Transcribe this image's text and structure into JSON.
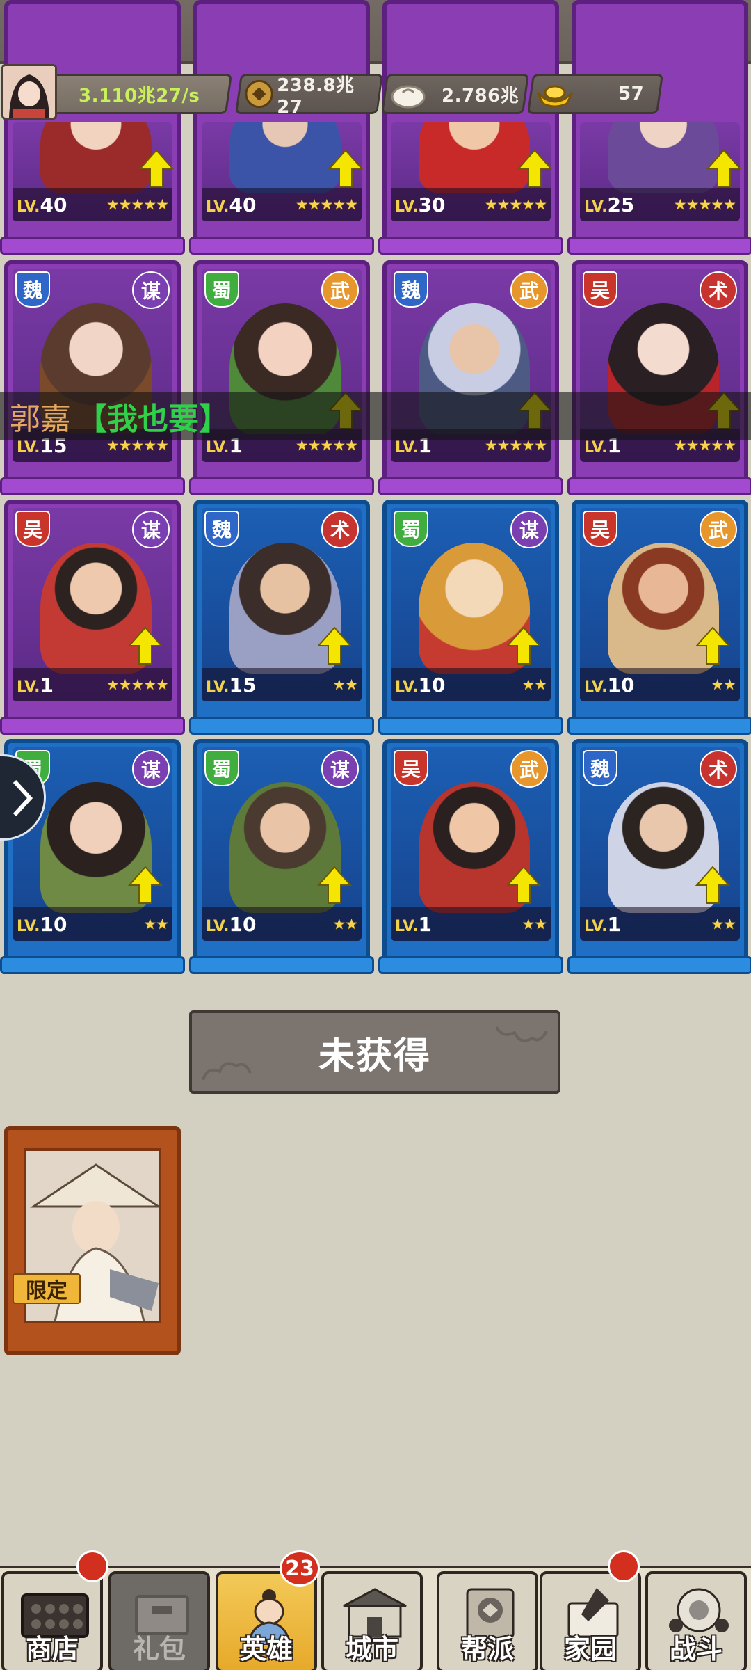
{
  "resources": {
    "income_rate": "3.110兆27/s",
    "copper": "238.8兆27",
    "buns": "2.786兆",
    "gold": "57"
  },
  "top_row_heroes": [
    {
      "level": "40",
      "stars": "★★★★★",
      "color": "purple"
    },
    {
      "level": "40",
      "stars": "★★★★★",
      "color": "purple"
    },
    {
      "level": "30",
      "stars": "★★★★★",
      "color": "purple"
    },
    {
      "level": "25",
      "stars": "★★★★★",
      "color": "purple"
    }
  ],
  "heroes": [
    {
      "faction": "魏",
      "type": "谋",
      "level": "15",
      "stars": "★★★★★",
      "color": "purple"
    },
    {
      "faction": "蜀",
      "type": "武",
      "level": "1",
      "stars": "★★★★★",
      "color": "purple"
    },
    {
      "faction": "魏",
      "type": "武",
      "level": "1",
      "stars": "★★★★★",
      "color": "purple"
    },
    {
      "faction": "吴",
      "type": "术",
      "level": "1",
      "stars": "★★★★★",
      "color": "purple"
    },
    {
      "faction": "吴",
      "type": "谋",
      "level": "1",
      "stars": "★★★★★",
      "color": "purple"
    },
    {
      "faction": "魏",
      "type": "术",
      "level": "15",
      "stars": "★★",
      "color": "blue"
    },
    {
      "faction": "蜀",
      "type": "谋",
      "level": "10",
      "stars": "★★",
      "color": "blue"
    },
    {
      "faction": "吴",
      "type": "武",
      "level": "10",
      "stars": "★★",
      "color": "blue"
    },
    {
      "faction": "蜀",
      "type": "谋",
      "level": "10",
      "stars": "★★",
      "color": "blue"
    },
    {
      "faction": "蜀",
      "type": "谋",
      "level": "10",
      "stars": "★★",
      "color": "blue"
    },
    {
      "faction": "吴",
      "type": "武",
      "level": "1",
      "stars": "★★",
      "color": "blue"
    },
    {
      "faction": "魏",
      "type": "术",
      "level": "1",
      "stars": "★★",
      "color": "blue"
    }
  ],
  "level_prefix": "LV.",
  "ticker": {
    "name": "郭嘉",
    "message": "【我也要】"
  },
  "unobtained_label": "未获得",
  "locked_card": {
    "tag": "限定"
  },
  "nav": [
    {
      "label": "商店",
      "icon": "abacus-icon"
    },
    {
      "label": "礼包",
      "icon": "gift-icon"
    },
    {
      "label": "英雄",
      "icon": "hero-icon"
    },
    {
      "label": "城市",
      "icon": "city-gate-icon"
    },
    {
      "label": "帮派",
      "icon": "gang-scroll-icon"
    },
    {
      "label": "家园",
      "icon": "home-brush-icon"
    },
    {
      "label": "战斗",
      "icon": "battle-icon"
    }
  ],
  "hero_badge_count": "23",
  "colors": {
    "accent": "#c9f15a",
    "purple_card": "#8b3db3",
    "blue_card": "#1f6fc4",
    "active_tab": "#f3c958"
  }
}
